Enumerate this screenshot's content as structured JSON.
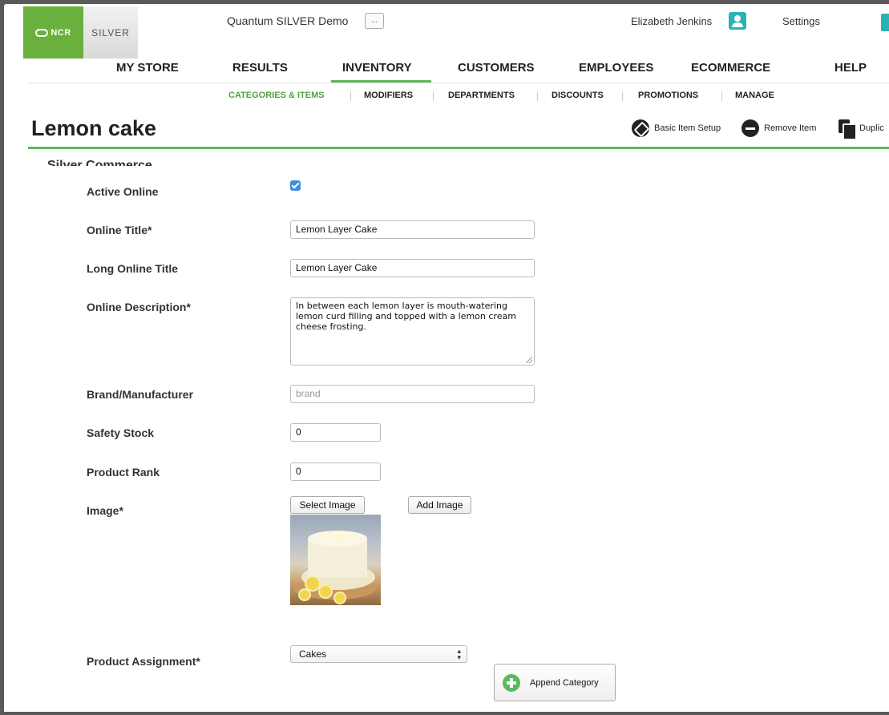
{
  "header": {
    "logo_ncr": "NCR",
    "logo_silver": "SILVER",
    "site_name": "Quantum SILVER Demo",
    "site_menu_label": "...",
    "user_name": "Elizabeth Jenkins",
    "settings_label": "Settings"
  },
  "main_nav": {
    "items": [
      "MY STORE",
      "RESULTS",
      "INVENTORY",
      "CUSTOMERS",
      "EMPLOYEES",
      "ECOMMERCE",
      "HELP"
    ],
    "active": "INVENTORY"
  },
  "sub_nav": {
    "items": [
      "CATEGORIES & ITEMS",
      "MODIFIERS",
      "DEPARTMENTS",
      "DISCOUNTS",
      "PROMOTIONS",
      "MANAGE"
    ],
    "active": "CATEGORIES & ITEMS"
  },
  "page": {
    "title": "Lemon cake",
    "actions": {
      "basic_item_setup": "Basic Item Setup",
      "remove_item": "Remove Item",
      "duplicate": "Duplic"
    },
    "section_heading": "Silver Commerce"
  },
  "form": {
    "active_online": {
      "label": "Active Online",
      "checked": true
    },
    "online_title": {
      "label": "Online Title*",
      "value": "Lemon Layer Cake"
    },
    "long_online_title": {
      "label": "Long Online Title",
      "value": "Lemon Layer Cake"
    },
    "online_description": {
      "label": "Online Description*",
      "value": "In between each lemon layer is mouth-watering lemon curd filling and topped with a lemon cream cheese frosting."
    },
    "brand": {
      "label": "Brand/Manufacturer",
      "value": "",
      "placeholder": "brand"
    },
    "safety_stock": {
      "label": "Safety Stock",
      "value": "0"
    },
    "product_rank": {
      "label": "Product Rank",
      "value": "0"
    },
    "image": {
      "label": "Image*",
      "select_button": "Select Image",
      "add_button": "Add Image"
    },
    "product_assignment": {
      "label": "Product Assignment*",
      "selected": "Cakes",
      "append_button": "Append Category"
    }
  },
  "colors": {
    "accent_green": "#5cb85c",
    "ncr_green": "#6ab03c",
    "user_teal": "#2bb3b1",
    "checkbox_blue": "#3b8de0"
  }
}
